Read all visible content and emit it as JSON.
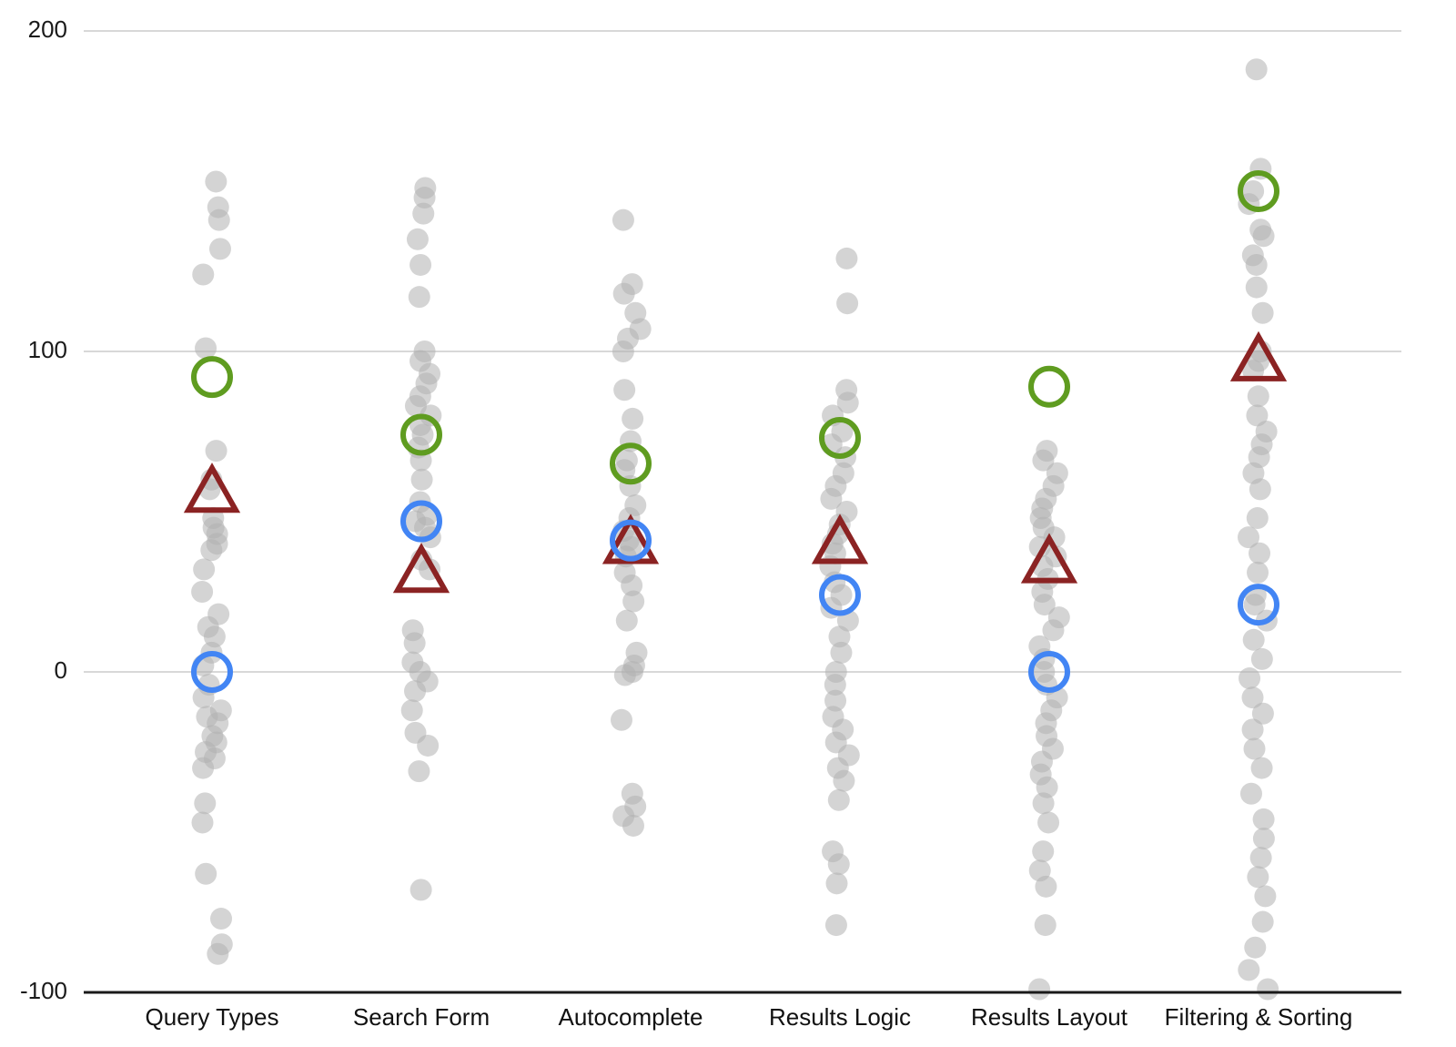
{
  "chart_data": {
    "type": "scatter",
    "title": "",
    "subtitle": "",
    "xlabel": "",
    "ylabel": "",
    "ylim": [
      -100,
      200
    ],
    "yticks": [
      200,
      100,
      0,
      -100
    ],
    "ytick_labels": [
      "200",
      "100",
      "0",
      "-100"
    ],
    "grid": "horizontal",
    "legend_position": "none",
    "categories": [
      "Query Types",
      "Search Form",
      "Autocomplete",
      "Results Logic",
      "Results Layout",
      "Filtering & Sorting"
    ],
    "colors": {
      "dot": "#b0b0b0",
      "green_circle": "#5f9c20",
      "red_triangle": "#8b2323",
      "blue_circle": "#4285f4",
      "gridline": "#d8d8d8",
      "axis": "#1a1a1a",
      "text": "#111111"
    },
    "marker_legend": [
      {
        "name": "green-circle",
        "symbol": "circle-outline",
        "color": "#5f9c20"
      },
      {
        "name": "red-triangle",
        "symbol": "triangle-outline",
        "color": "#8b2323"
      },
      {
        "name": "blue-circle",
        "symbol": "circle-outline",
        "color": "#4285f4"
      }
    ],
    "series": [
      {
        "name": "green-circle",
        "marker": "circle-outline",
        "color": "#5f9c20",
        "values": [
          92,
          74,
          65,
          73,
          89,
          150
        ]
      },
      {
        "name": "red-triangle",
        "marker": "triangle-outline",
        "color": "#8b2323",
        "values": [
          56,
          31,
          40,
          40,
          34,
          97
        ]
      },
      {
        "name": "blue-circle",
        "marker": "circle-outline",
        "color": "#4285f4",
        "values": [
          0,
          47,
          41,
          24,
          0,
          21
        ]
      }
    ],
    "points": [
      {
        "category": "Query Types",
        "values": [
          153,
          145,
          141,
          132,
          124,
          101,
          69,
          60,
          57,
          48,
          45,
          43,
          40,
          38,
          32,
          25,
          18,
          14,
          11,
          6,
          2,
          -4,
          -8,
          -12,
          -14,
          -16,
          -20,
          -22,
          -25,
          -27,
          -30,
          -41,
          -47,
          -63,
          -77,
          -85,
          -88
        ]
      },
      {
        "category": "Search Form",
        "values": [
          151,
          148,
          143,
          135,
          127,
          117,
          100,
          97,
          93,
          90,
          86,
          83,
          80,
          77,
          74,
          70,
          66,
          60,
          53,
          49,
          47,
          45,
          42,
          35,
          32,
          13,
          9,
          3,
          0,
          -3,
          -6,
          -12,
          -19,
          -23,
          -31,
          -68
        ]
      },
      {
        "category": "Autocomplete",
        "values": [
          141,
          121,
          118,
          112,
          107,
          104,
          100,
          88,
          79,
          72,
          66,
          63,
          58,
          52,
          48,
          44,
          41,
          39,
          36,
          31,
          27,
          22,
          16,
          6,
          2,
          0,
          -1,
          -15,
          -38,
          -42,
          -45,
          -48
        ]
      },
      {
        "category": "Results Logic",
        "values": [
          129,
          115,
          88,
          84,
          80,
          75,
          71,
          67,
          62,
          58,
          54,
          50,
          46,
          43,
          40,
          37,
          33,
          28,
          24,
          20,
          16,
          11,
          6,
          0,
          -4,
          -9,
          -14,
          -18,
          -22,
          -26,
          -30,
          -34,
          -40,
          -56,
          -60,
          -66,
          -79
        ]
      },
      {
        "category": "Results Layout",
        "values": [
          69,
          66,
          62,
          58,
          54,
          51,
          48,
          45,
          42,
          39,
          36,
          33,
          29,
          25,
          21,
          17,
          13,
          8,
          4,
          0,
          -4,
          -8,
          -12,
          -16,
          -20,
          -24,
          -28,
          -32,
          -36,
          -41,
          -47,
          -56,
          -62,
          -67,
          -79,
          -99
        ]
      },
      {
        "category": "Filtering & Sorting",
        "values": [
          188,
          157,
          150,
          146,
          138,
          136,
          130,
          127,
          120,
          112,
          100,
          97,
          94,
          86,
          80,
          75,
          71,
          67,
          62,
          57,
          48,
          42,
          37,
          31,
          24,
          21,
          16,
          10,
          4,
          -2,
          -8,
          -13,
          -18,
          -24,
          -30,
          -38,
          -46,
          -52,
          -58,
          -64,
          -70,
          -78,
          -86,
          -93,
          -99
        ]
      }
    ]
  },
  "axis": {
    "y_labels": [
      "200",
      "100",
      "0",
      "-100"
    ],
    "x_labels": [
      "Query Types",
      "Search Form",
      "Autocomplete",
      "Results Logic",
      "Results Layout",
      "Filtering & Sorting"
    ]
  }
}
